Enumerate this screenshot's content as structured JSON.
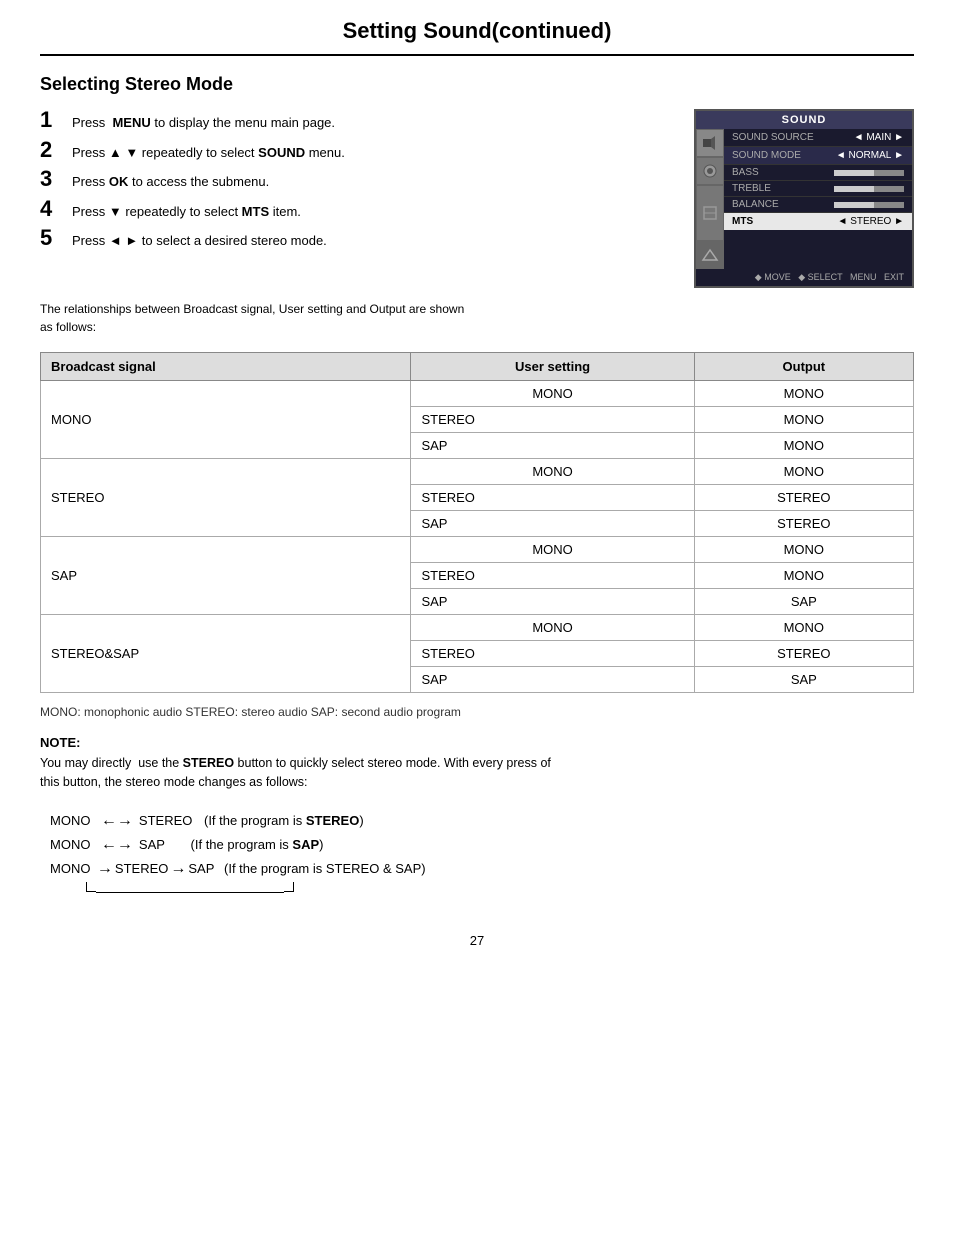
{
  "page": {
    "title": "Setting Sound(continued)",
    "number": "27"
  },
  "section": {
    "title": "Selecting Stereo Mode"
  },
  "steps": [
    {
      "number": "1",
      "text": "Press ",
      "key": "MENU",
      "rest": " to display the menu main page."
    },
    {
      "number": "2",
      "text": "Press ▲ ▼ repeatedly to select ",
      "key": "SOUND",
      "rest": " menu."
    },
    {
      "number": "3",
      "text": "Press ",
      "key": "OK",
      "rest": " to access the submenu."
    },
    {
      "number": "4",
      "text": "Press ▼ repeatedly to select ",
      "key": "MTS",
      "rest": " item."
    },
    {
      "number": "5",
      "text": "Press ◄ ► to select a desired stereo mode."
    }
  ],
  "description": "The relationships between Broadcast signal, User setting and Output are shown\nas follows:",
  "tv_menu": {
    "title": "SOUND",
    "rows": [
      {
        "label": "SOUND SOURCE",
        "value": "◄  MAIN  ►"
      },
      {
        "label": "SOUND MODE",
        "value": "◄  NORMAL  ►"
      },
      {
        "label": "BASS",
        "value": ""
      },
      {
        "label": "TREBLE",
        "value": ""
      },
      {
        "label": "BALANCE",
        "value": ""
      },
      {
        "label": "MTS",
        "value": "◄  STEREO  ►"
      }
    ],
    "footer": "◆ MOVE   ◆ SELECT   MENU  EXIT"
  },
  "table": {
    "headers": [
      "Broadcast signal",
      "User setting",
      "Output"
    ],
    "rows": [
      {
        "signal": "MONO",
        "span": 3,
        "settings": [
          "MONO",
          "STEREO",
          "SAP"
        ],
        "outputs": [
          "MONO",
          "MONO",
          "MONO"
        ]
      },
      {
        "signal": "STEREO",
        "span": 3,
        "settings": [
          "MONO",
          "STEREO",
          "SAP"
        ],
        "outputs": [
          "MONO",
          "STEREO",
          "STEREO"
        ]
      },
      {
        "signal": "SAP",
        "span": 3,
        "settings": [
          "MONO",
          "STEREO",
          "SAP"
        ],
        "outputs": [
          "MONO",
          "MONO",
          "SAP"
        ]
      },
      {
        "signal": "STEREO&SAP",
        "span": 3,
        "settings": [
          "MONO",
          "STEREO",
          "SAP"
        ],
        "outputs": [
          "MONO",
          "STEREO",
          "SAP"
        ]
      }
    ]
  },
  "legend": "MONO: monophonic audio       STEREO: stereo audio              SAP: second audio program",
  "note": {
    "title": "NOTE:",
    "text1": "You may directly  use the ",
    "key1": "STEREO",
    "text2": " button to quickly select stereo mode. With every press of",
    "text3": "this button, the stereo mode changes as follows:"
  },
  "diagram": {
    "row1": {
      "start": "MONO",
      "arrow": "⟵⟶",
      "mid": "STEREO",
      "note": "(If the program is ",
      "noteKey": "STEREO",
      "noteEnd": ")"
    },
    "row2": {
      "start": "MONO",
      "arrow": "⟵⟶",
      "mid": "SAP",
      "note": "(If the program is ",
      "noteKey": "SAP",
      "noteEnd": ")"
    },
    "row3": {
      "start": "MONO",
      "arrow1": "⟶",
      "mid1": "STEREO",
      "arrow2": "⟶",
      "mid2": "SAP",
      "note": "(If the program is ",
      "noteKey": "STEREO & SAP",
      "noteEnd": ")"
    }
  }
}
